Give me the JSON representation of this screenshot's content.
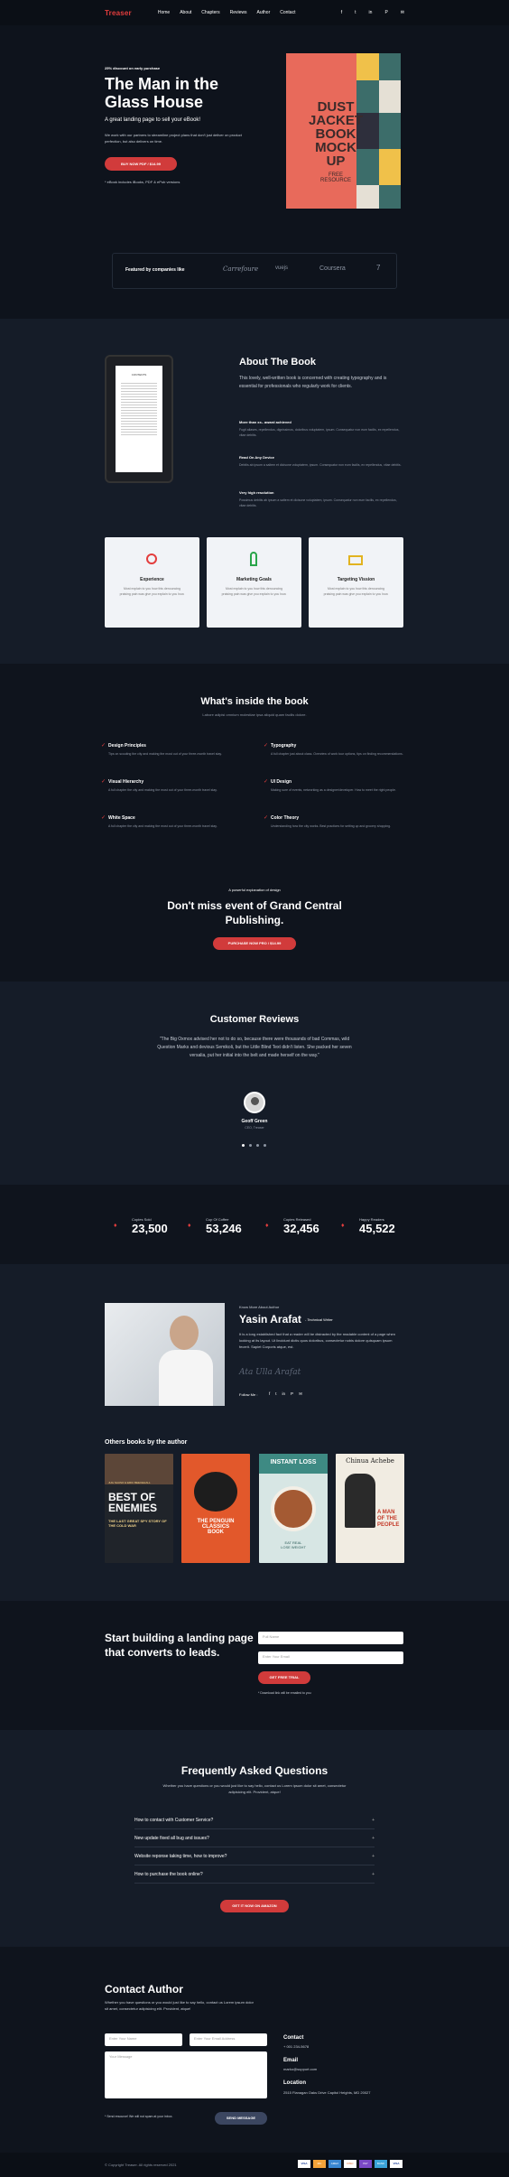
{
  "nav": {
    "logo_main": "Treaser",
    "menu": [
      "Home",
      "About",
      "Chapters",
      "Reviews",
      "Author",
      "Contact"
    ],
    "social": [
      "f",
      "t",
      "in",
      "P",
      "✉"
    ]
  },
  "hero": {
    "discount": "25% discount on early purchase",
    "title": "The Man in the Glass House",
    "subtitle": "A great landing page to sell your eBook!",
    "body": "We work with our partners to streamline project plans that don't just deliver on product perfection, but also delivers on time.",
    "button": "BUY NOW PDF  /  $14.99",
    "note": "* eBook includes iBooks, PDF & ePub versions",
    "cover_line1": "DUST",
    "cover_line2": "JACKET",
    "cover_line3": "BOOK",
    "cover_line4": "MOCK",
    "cover_line5": "UP",
    "cover_sub1": "FREE",
    "cover_sub2": "RESOURCE"
  },
  "featured": {
    "label": "Featured by companies like",
    "logos": [
      "Carrefoure",
      "vuejs",
      "Coursera",
      "7"
    ]
  },
  "about": {
    "title": "About The Book",
    "intro": "This lovely, well-written book is concerned with creating typography and is essential for professionals who regularly work for clients.",
    "items": [
      {
        "title": "More than xx– award achieved",
        "text": "Fugit aliases, repellendus, dignissimos, doloribus voluptatem, ipsum. Consequatur non eum facilis, ex repellendus, vitae debitis."
      },
      {
        "title": "Read On Any Device",
        "text": "Debitis ab ipsum a saltem et dicisone voluptatem, ipsum. Consequatur non eum facilis, ex repellendus, vitae debitis."
      },
      {
        "title": "Very high resolution",
        "text": "Possimus debitis ab ipsum a saltem et dicisone voluptatem, ipsum. Consequatur non eum facilis, ex repellendus, vitae debitis."
      }
    ],
    "tablet_heading": "CONTENTS"
  },
  "cards": [
    {
      "title": "Experience",
      "text": "Most explain to you how this denouncing praising pain was give you explain to you how.",
      "icon_color": "#e33d3d"
    },
    {
      "title": "Marketing Goals",
      "text": "Most explain to you how this denouncing praising pain was give you explain to you how.",
      "icon_color": "#2aa54a"
    },
    {
      "title": "Targeting Vission",
      "text": "Most explain to you how this denouncing praising pain was give you explain to you how.",
      "icon_color": "#e2b320"
    }
  ],
  "inside": {
    "title": "What's inside the book",
    "subtitle": "Labore adipisi omnium molestiae ipsa aliquid quam facilis dolore.",
    "features": [
      {
        "title": "Design Principles",
        "text": "Tips on scouting the city and making the most out of your three-month travel stay."
      },
      {
        "title": "Typography",
        "text": "A full chapter just about class. Overview of work tour options, tips on finding recommendations."
      },
      {
        "title": "Visual Hierarchy",
        "text": "A full chapter the city and making the most out of your three-month travel stay."
      },
      {
        "title": "UI Design",
        "text": "Making sure of events, networking as a designer/developer. How to meet the right people."
      },
      {
        "title": "White Space",
        "text": "A full chapter the city and making the most out of your three-month travel stay."
      },
      {
        "title": "Color Theory",
        "text": "Understanding how the city works. Best practices for setting up and grocery shopping."
      }
    ],
    "event_pre": "A powerful explanation of design",
    "event_title": "Don't miss event of Grand Central Publishing.",
    "event_button": "PURCHASE NOW PRO  /  $14.99"
  },
  "reviews": {
    "title": "Customer Reviews",
    "quote": "\"The Big Oxmox advised her not to do so, because there were thousands of bad Commas, wild Question Marks and devious Semikoli, but the Little Blind Text didn't listen. She packed her seven versalia, put her initial into the belt and made herself on the way.\"",
    "name": "Geoff Green",
    "role": "CEO, Treaser"
  },
  "stats": [
    {
      "label": "Copies Sold",
      "value": "23,500"
    },
    {
      "label": "Cup Of Coffee",
      "value": "53,246"
    },
    {
      "label": "Copies Released",
      "value": "32,456"
    },
    {
      "label": "Happy Readers",
      "value": "45,522"
    }
  ],
  "author": {
    "pre": "Know More About Author",
    "name": "Yasin Arafat",
    "role": "- Technical Writer",
    "bio": "It is a long established fact that a reader will be distracted by the readable content of a page when looking at its layout. Ut lincidunt dictis quos doloribus, consectetur nobis dolore quisquam ipsum fecerit. Sapiet Corporis atque, est.",
    "signature": "Ata Ulla Arafat",
    "follow": "Follow Me :"
  },
  "others": {
    "title": "Others books by the author",
    "books": [
      {
        "top": "JUG SAUSO & ERIC BEECEHALL",
        "big1": "BEST OF",
        "big2": "ENEMIES",
        "sub": "THE LAST GREAT SPY STORY OF THE COLD WAR"
      },
      {
        "top": "THE PENGUIN",
        "big1": "CLASSICS",
        "big2": "BOOK",
        "sub": ""
      },
      {
        "top": "INSTANT LOSS",
        "big1": "EAT REAL",
        "big2": "LOSE WEIGHT",
        "sub": ""
      },
      {
        "top": "Chinua Achebe",
        "big1": "A MAN",
        "big2": "OF THE PEOPLE",
        "sub": ""
      }
    ]
  },
  "cta": {
    "title": "Start building a landing page that converts to leads.",
    "full_name": "Full Name",
    "email": "Enter Your Email",
    "button": "GET FREE TRIAL",
    "note": "* Download link will be emailed to you"
  },
  "faq": {
    "title": "Frequently Asked Questions",
    "subtitle": "Whether you have questions or you would just like to say hello, contact us Lorem ipsum dolor sit amet, consectetur adipisicing elit. Provident, atque!",
    "questions": [
      "How to contact with Customer Service?",
      "New update fixed all bug and issues?",
      "Website reponse taking time, how to improve?",
      "How to purchase the book online?"
    ],
    "button": "GET IT NOW ON AMAZON"
  },
  "contact": {
    "title": "Contact Author",
    "intro": "Whether you have questions or you would just like to say hello, contact us Lorem ipsum dolor sit amet, consectetur adipisicing elit. Provident, atque!",
    "name_ph": "Enter Your Name",
    "email_ph": "Enter Your Email Address",
    "message_ph": "Your Message",
    "note": "* Send resource! We will not spam at your inbox.",
    "send": "SEND MESSAGE",
    "phone_label": "Contact",
    "phone": "+ 001 234-5678",
    "email_label": "Email",
    "email": "marko@support.com",
    "location_label": "Location",
    "location": "2515 Flanagan Oaks Drive Capitol Heights, MD 20027"
  },
  "footer": {
    "copyright": "© Copyright Treaser. All rights reserved 2021",
    "payments": [
      "VISA",
      "MC",
      "AMEX",
      "DISC",
      "PAY",
      "BANK",
      "VISA"
    ]
  }
}
